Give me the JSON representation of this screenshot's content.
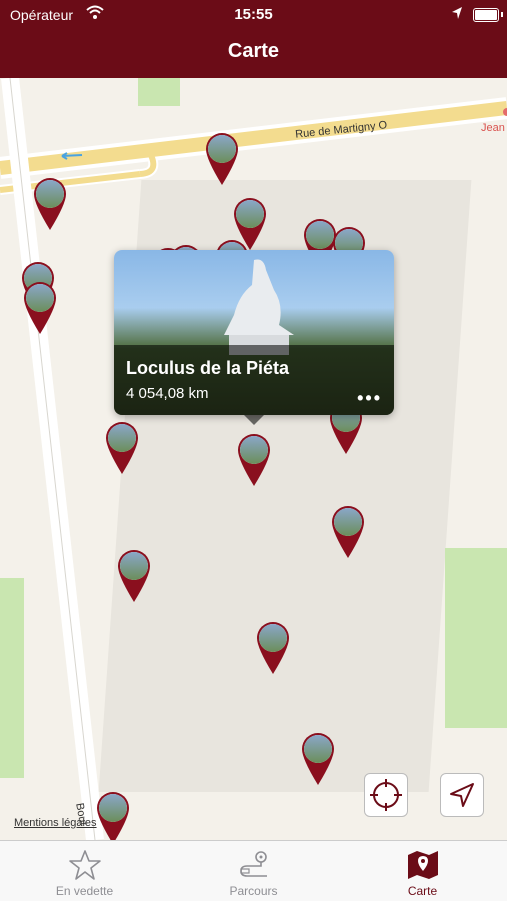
{
  "status_bar": {
    "carrier": "Opérateur",
    "time": "15:55"
  },
  "nav": {
    "title": "Carte"
  },
  "map": {
    "street_top": "Rue de Martigny O",
    "street_side": "Boul",
    "edge_label": "Jean",
    "legal": "Mentions légales"
  },
  "callout": {
    "name": "Loculus de la Piéta",
    "distance": "4 054,08 km"
  },
  "tabs": [
    {
      "label": "En vedette",
      "icon": "star-icon"
    },
    {
      "label": "Parcours",
      "icon": "route-icon"
    },
    {
      "label": "Carte",
      "icon": "map-icon"
    }
  ],
  "colors": {
    "brand": "#6b0c17",
    "inactive_tab": "#8e8e93"
  }
}
